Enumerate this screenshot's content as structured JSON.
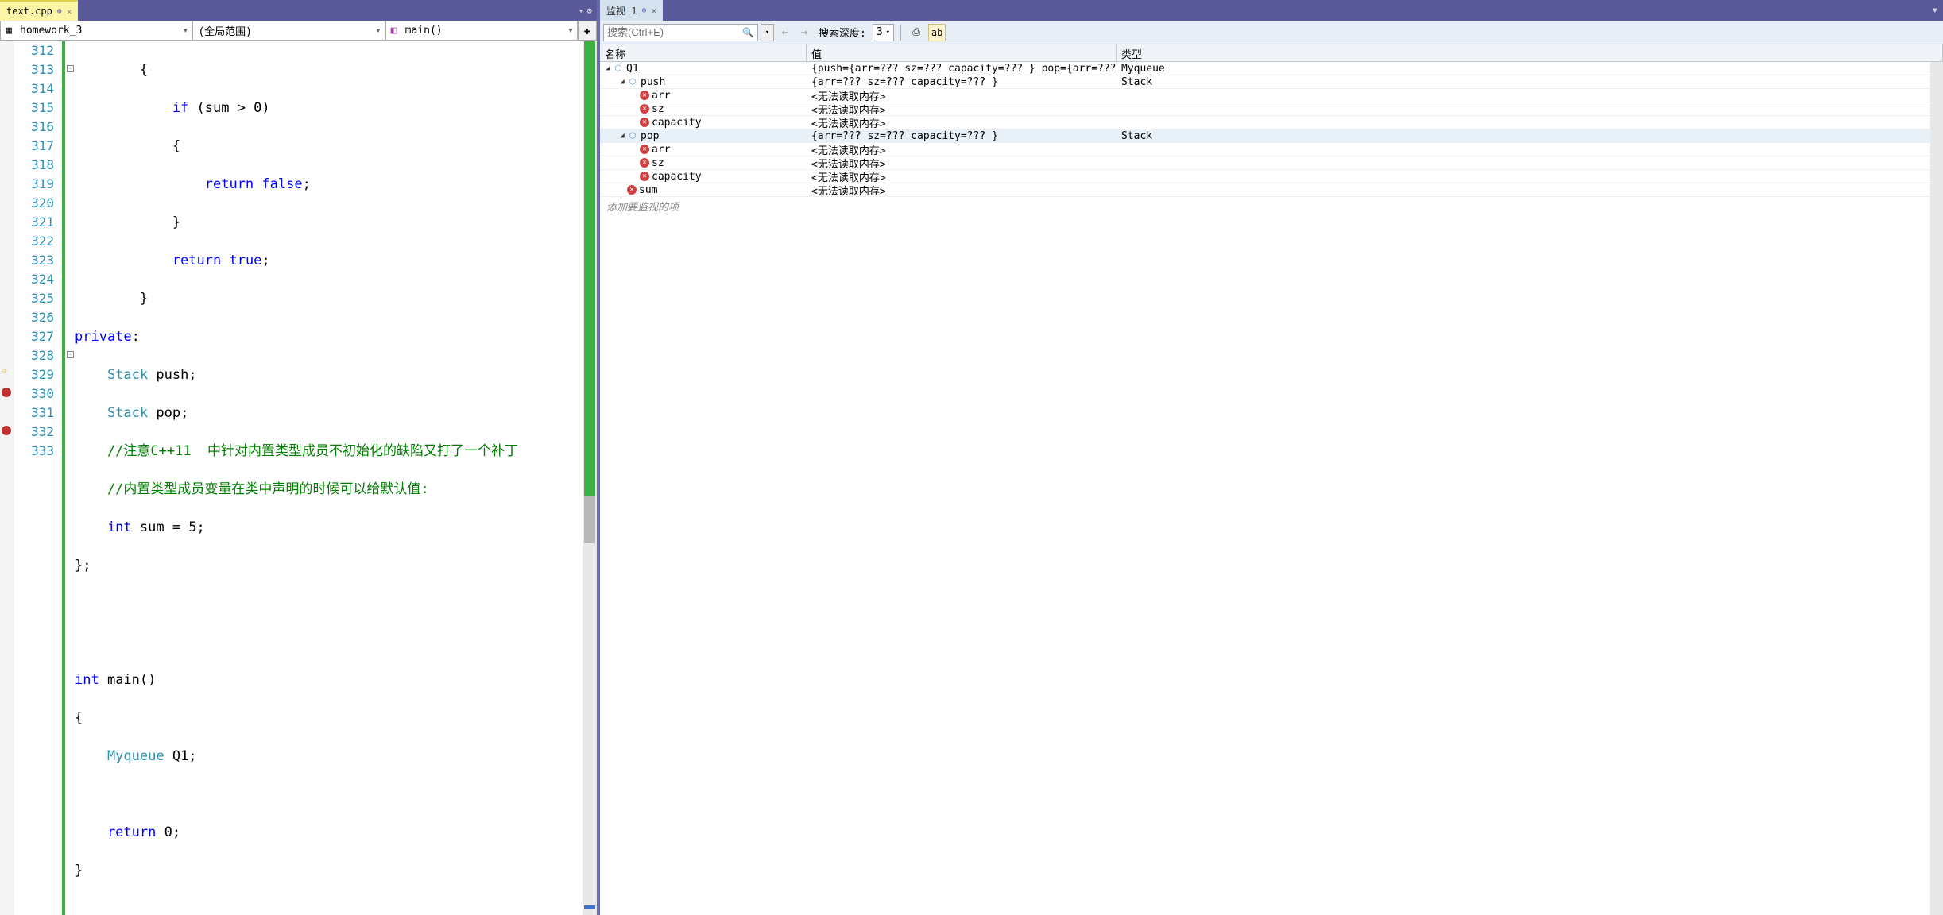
{
  "tabs": {
    "file_tab": "text.cpp",
    "watch_tab": "监视 1"
  },
  "nav": {
    "scope1": "homework_3",
    "scope2": "(全局范围)",
    "scope3": "main()"
  },
  "lines": [
    "312",
    "313",
    "314",
    "315",
    "316",
    "317",
    "318",
    "319",
    "320",
    "321",
    "322",
    "323",
    "324",
    "325",
    "326",
    "327",
    "328",
    "329",
    "330",
    "331",
    "332",
    "333"
  ],
  "code": {
    "l312": "        {",
    "l313_a": "            if",
    "l313_b": " (sum > 0)",
    "l314": "            {",
    "l315_a": "                return",
    "l315_b": " false",
    "l315_c": ";",
    "l316": "            }",
    "l317_a": "            return",
    "l317_b": " true",
    "l317_c": ";",
    "l318": "        }",
    "l319_a": "private",
    "l319_b": ":",
    "l320_a": "    Stack",
    "l320_b": " push;",
    "l321_a": "    Stack",
    "l321_b": " pop;",
    "l322": "    //注意C++11  中针对内置类型成员不初始化的缺陷又打了一个补丁",
    "l323": "    //内置类型成员变量在类中声明的时候可以给默认值:",
    "l324_a": "    int",
    "l324_b": " sum = 5;",
    "l325": "};",
    "l326": "",
    "l327": "",
    "l328_a": "int",
    "l328_b": " main()",
    "l329": "{",
    "l330_a": "    Myqueue",
    "l330_b": " Q1;",
    "l331": "",
    "l332_a": "    return",
    "l332_b": " 0;",
    "l333": "}"
  },
  "watch": {
    "search_placeholder": "搜索(Ctrl+E)",
    "depth_label": "搜索深度:",
    "depth_value": "3",
    "header_name": "名称",
    "header_value": "值",
    "header_type": "类型",
    "add_item": "添加要监视的项",
    "rows": {
      "q1_name": "Q1",
      "q1_value": "{push={arr=??? sz=??? capacity=??? } pop={arr=??? sz=??? capacity=??? } su...",
      "q1_type": "Myqueue",
      "push_name": "push",
      "push_value": "{arr=??? sz=??? capacity=??? }",
      "push_type": "Stack",
      "pop_name": "pop",
      "pop_value": "{arr=??? sz=??? capacity=??? }",
      "pop_type": "Stack",
      "arr_name": "arr",
      "sz_name": "sz",
      "cap_name": "capacity",
      "sum_name": "sum",
      "err_value": "<无法读取内存>"
    }
  }
}
